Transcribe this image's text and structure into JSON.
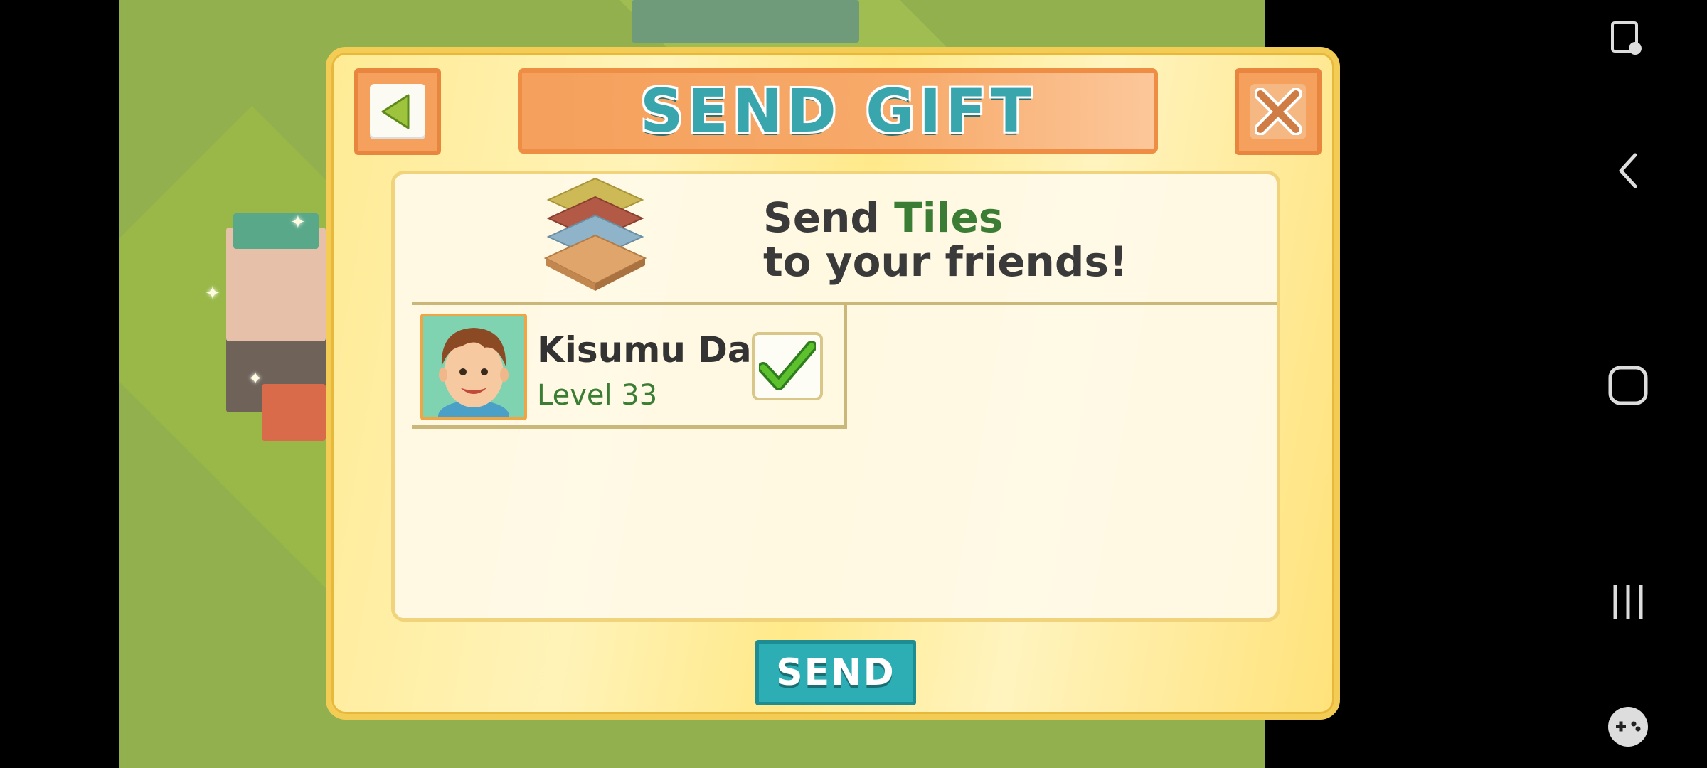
{
  "dialog": {
    "title": "SEND GIFT",
    "headline_prefix": "Send ",
    "headline_item": "Tiles",
    "headline_suffix": "to your friends!",
    "send_label": "SEND"
  },
  "friends": [
    {
      "name": "Kisumu Dalal",
      "level": "Level 33",
      "selected": true
    }
  ],
  "icons": {
    "back": "back-arrow-icon",
    "close": "close-icon",
    "item": "tiles-stack-icon",
    "check": "checkmark-icon"
  },
  "nav_icons": [
    "screen-touch-icon",
    "back-icon",
    "home-icon",
    "recents-icon",
    "game-controller-icon"
  ],
  "colors": {
    "title_text": "#39a6ad",
    "accent_green": "#3c7d35",
    "send_button": "#2daeb5",
    "banner_orange": "#f5a05c"
  }
}
